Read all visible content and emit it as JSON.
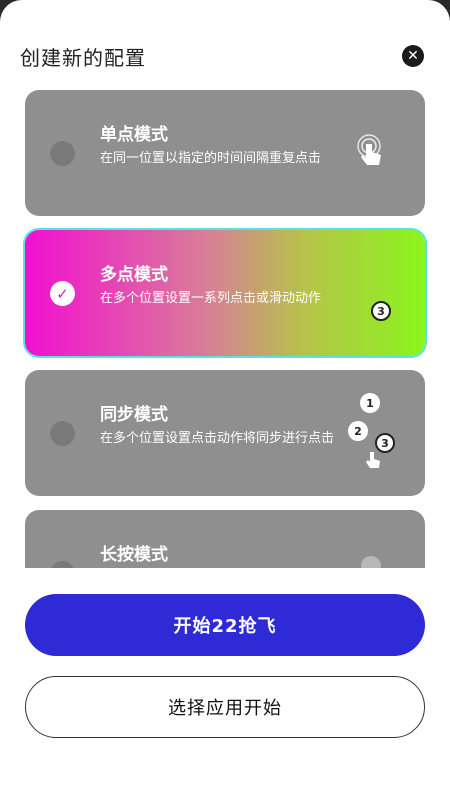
{
  "dialog": {
    "title": "创建新的配置",
    "close_icon": "close-icon"
  },
  "modes": [
    {
      "title": "单点模式",
      "description": "在同一位置以指定的时间间隔重复点击",
      "selected": false,
      "icon": "tap-hand-icon"
    },
    {
      "title": "多点模式",
      "description": "在多个位置设置一系列点击或滑动动作",
      "selected": true,
      "icon": "multi-point-icon",
      "badge": "3"
    },
    {
      "title": "同步模式",
      "description": "在多个位置设置点击动作将同步进行点击",
      "selected": false,
      "icon": "sync-points-icon",
      "badges": [
        "1",
        "2",
        "3"
      ]
    },
    {
      "title": "长按模式",
      "description": "",
      "selected": false,
      "icon": "long-press-icon"
    }
  ],
  "actions": {
    "primary_label": "开始22抢飞",
    "secondary_label": "选择应用开始"
  },
  "colors": {
    "primary_button": "#2e2ad6",
    "card_inactive": "#8f8f8f",
    "card_active_gradient_start": "#f20fd1",
    "card_active_gradient_end": "#8af51c",
    "active_border": "#57e3e3"
  }
}
